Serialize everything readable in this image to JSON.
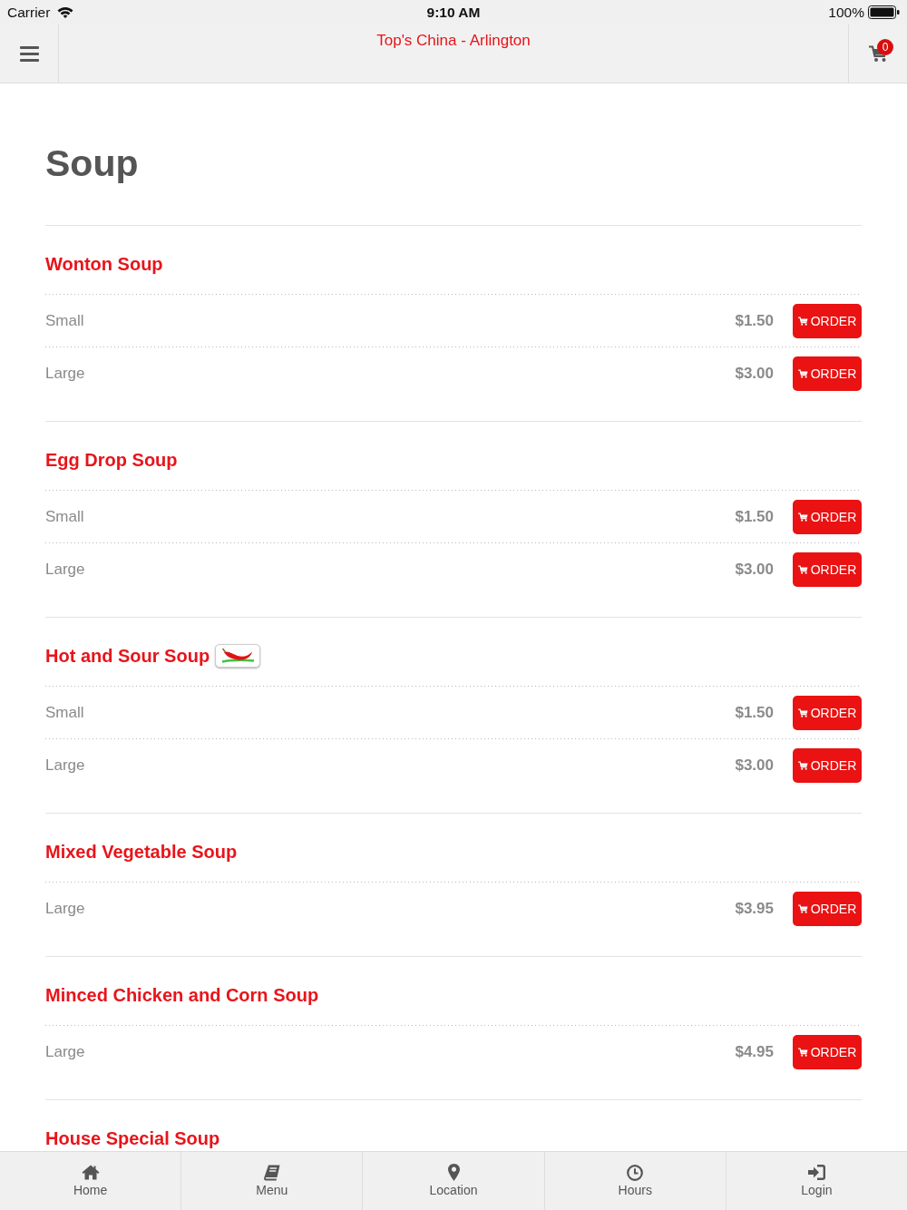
{
  "status_bar": {
    "carrier": "Carrier",
    "time": "9:10 AM",
    "battery": "100%"
  },
  "header": {
    "title": "Top's China - Arlington",
    "cart_count": "0"
  },
  "page_title": "Soup",
  "sections": [
    {
      "name": "Wonton Soup",
      "spicy": false,
      "items": [
        {
          "size": "Small",
          "price": "$1.50",
          "button": "ORDER"
        },
        {
          "size": "Large",
          "price": "$3.00",
          "button": "ORDER"
        }
      ]
    },
    {
      "name": "Egg Drop Soup",
      "spicy": false,
      "items": [
        {
          "size": "Small",
          "price": "$1.50",
          "button": "ORDER"
        },
        {
          "size": "Large",
          "price": "$3.00",
          "button": "ORDER"
        }
      ]
    },
    {
      "name": "Hot and Sour Soup",
      "spicy": true,
      "items": [
        {
          "size": "Small",
          "price": "$1.50",
          "button": "ORDER"
        },
        {
          "size": "Large",
          "price": "$3.00",
          "button": "ORDER"
        }
      ]
    },
    {
      "name": "Mixed Vegetable Soup",
      "spicy": false,
      "items": [
        {
          "size": "Large",
          "price": "$3.95",
          "button": "ORDER"
        }
      ]
    },
    {
      "name": "Minced Chicken and Corn Soup",
      "spicy": false,
      "items": [
        {
          "size": "Large",
          "price": "$4.95",
          "button": "ORDER"
        }
      ]
    },
    {
      "name": "House Special Soup",
      "spicy": false
    }
  ],
  "tab_bar": [
    {
      "kind": "home",
      "label": "Home"
    },
    {
      "kind": "menu",
      "label": "Menu"
    },
    {
      "kind": "location",
      "label": "Location"
    },
    {
      "kind": "hours",
      "label": "Hours"
    },
    {
      "kind": "login",
      "label": "Login"
    }
  ]
}
